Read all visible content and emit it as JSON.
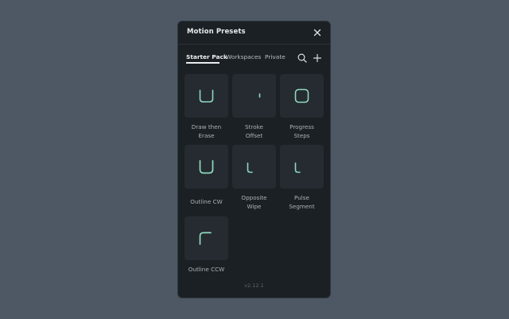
{
  "panel": {
    "title": "Motion Presets",
    "close_icon": "close-icon"
  },
  "tabs": [
    {
      "label": "Starter Pack",
      "active": true
    },
    {
      "label": "Workspaces",
      "active": false
    },
    {
      "label": "Private",
      "active": false
    }
  ],
  "toolbar": {
    "search_icon": "search-icon",
    "add_icon": "plus-icon"
  },
  "presets": [
    {
      "line1": "Draw then",
      "line2": "Erase",
      "icon": "u-shape-icon"
    },
    {
      "line1": "Stroke",
      "line2": "Offset",
      "icon": "dash-icon"
    },
    {
      "line1": "Progress",
      "line2": "Steps",
      "icon": "rounded-square-icon"
    },
    {
      "line1": "Outline CW",
      "line2": "",
      "icon": "u-shape-thick-icon"
    },
    {
      "line1": "Opposite",
      "line2": "Wipe",
      "icon": "l-shape-icon"
    },
    {
      "line1": "Pulse",
      "line2": "Segment",
      "icon": "l-shape-icon"
    },
    {
      "line1": "Outline CCW",
      "line2": "",
      "icon": "c-shape-icon"
    }
  ],
  "footer": {
    "version": "v2.12.1"
  },
  "colors": {
    "accent": "#8fd9c0",
    "panel_bg": "#1b2024",
    "card_bg": "#252b30",
    "page_bg": "#4d5864"
  }
}
